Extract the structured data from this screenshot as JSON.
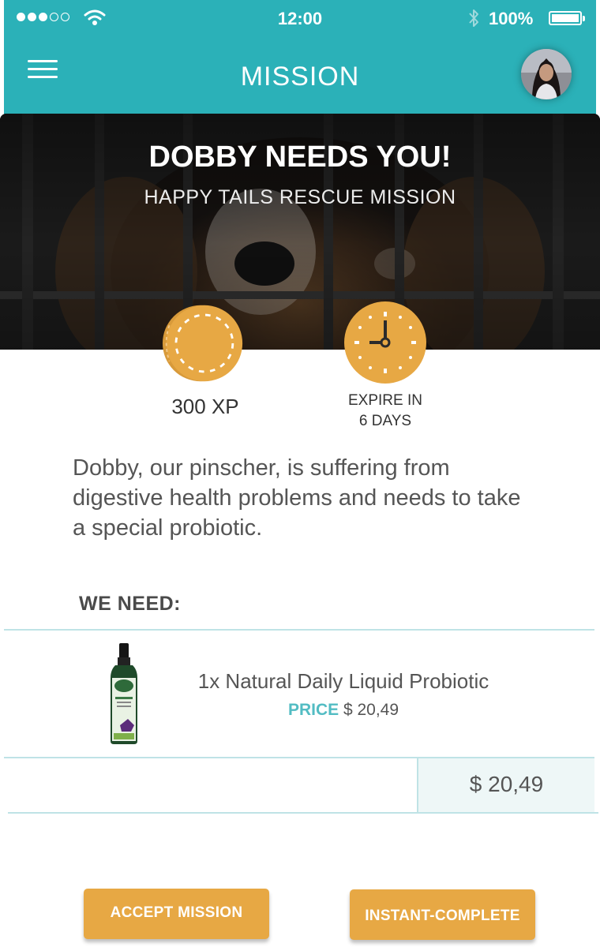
{
  "status_bar": {
    "time": "12:00",
    "battery_percent": "100%",
    "signal_bars_filled": 3,
    "signal_bars_total": 5
  },
  "header": {
    "title": "MISSION"
  },
  "hero": {
    "title": "DOBBY NEEDS YOU!",
    "subtitle": "HAPPY TAILS RESCUE MISSION"
  },
  "stats": {
    "xp": "300 XP",
    "expire_line1": "EXPIRE IN",
    "expire_line2": "6 DAYS"
  },
  "description": "Dobby, our pinscher, is suffering from digestive health problems and needs to take a special probiotic.",
  "needs": {
    "heading": "WE NEED:",
    "items": [
      {
        "name": "1x Natural Daily Liquid Probiotic",
        "price_label": "PRICE",
        "price": "$ 20,49"
      }
    ],
    "total": "$ 20,49"
  },
  "actions": {
    "accept_label": "ACCEPT MISSION",
    "instant_label": "INSTANT-COMPLETE"
  },
  "colors": {
    "header": "#2bb1b8",
    "accent": "#e7a844",
    "price_label": "#52bcc3",
    "divider": "#bfe3e6"
  },
  "icons": [
    "signal-icon",
    "wifi-icon",
    "bluetooth-icon",
    "battery-icon",
    "menu-icon",
    "coin-icon",
    "clock-icon"
  ]
}
